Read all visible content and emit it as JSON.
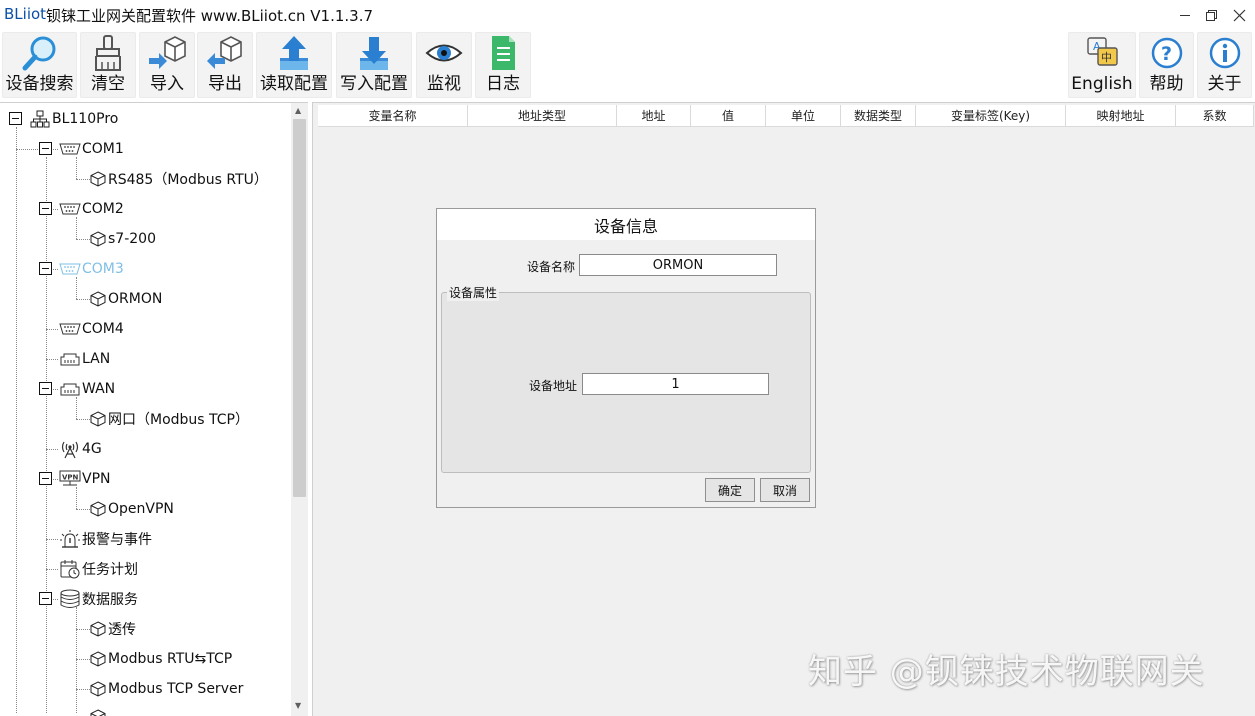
{
  "window": {
    "brand": "BLiiot",
    "title": "钡铼工业网关配置软件 www.BLiiot.cn V1.1.3.7",
    "icons": [
      "minimize-icon",
      "restore-icon",
      "close-icon"
    ]
  },
  "toolbar": {
    "search": "设备搜索",
    "clear": "清空",
    "import": "导入",
    "export": "导出",
    "read_config": "读取配置",
    "write_config": "写入配置",
    "monitor": "监视",
    "log": "日志",
    "english": "English",
    "help": "帮助",
    "about": "关于"
  },
  "tree": {
    "root": "BL110Pro",
    "com1": "COM1",
    "com1_dev": "RS485（Modbus RTU）",
    "com2": "COM2",
    "com2_dev": "s7-200",
    "com3": "COM3",
    "com3_dev": "ORMON",
    "com4": "COM4",
    "lan": "LAN",
    "wan": "WAN",
    "wan_dev": "网口（Modbus TCP）",
    "g4": "4G",
    "vpn": "VPN",
    "vpn_dev": "OpenVPN",
    "alarm": "报警与事件",
    "task": "任务计划",
    "data_service": "数据服务",
    "transparent": "透传",
    "rtu_tcp": "Modbus RTU⇆TCP",
    "tcp_server": "Modbus TCP Server"
  },
  "grid": {
    "columns": [
      "变量名称",
      "地址类型",
      "地址",
      "值",
      "单位",
      "数据类型",
      "变量标签(Key)",
      "映射地址",
      "系数"
    ]
  },
  "dialog": {
    "title": "设备信息",
    "name_label": "设备名称",
    "name_value": "ORMON",
    "group_label": "设备属性",
    "addr_label": "设备地址",
    "addr_value": "1",
    "ok": "确定",
    "cancel": "取消"
  },
  "watermark": "知乎 @钡铼技术物联网关",
  "colors": {
    "brand_blue": "#0a50a8",
    "selected_tree": "#7fbfe6",
    "toolbar_bg": "#f3f3f3",
    "panel_bg": "#f0f0f0"
  }
}
